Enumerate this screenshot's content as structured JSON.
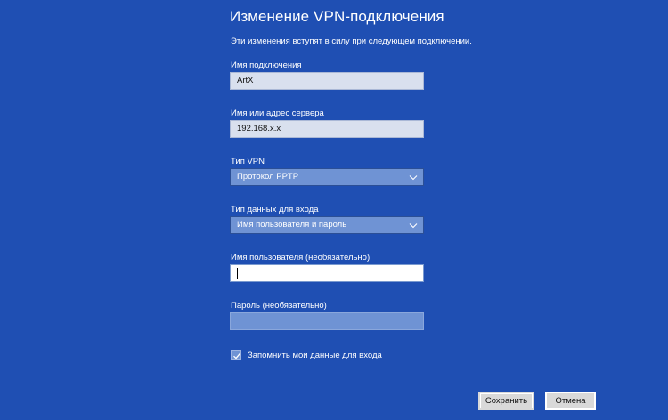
{
  "dialog": {
    "title": "Изменение VPN-подключения",
    "subtitle": "Эти изменения вступят в силу при следующем подключении."
  },
  "fields": {
    "connection_name": {
      "label": "Имя подключения",
      "value": "ArtX"
    },
    "server_address": {
      "label": "Имя или адрес сервера",
      "value": "192.168.x.x"
    },
    "vpn_type": {
      "label": "Тип VPN",
      "selected": "Протокол PPTP"
    },
    "signin_type": {
      "label": "Тип данных для входа",
      "selected": "Имя пользователя и пароль"
    },
    "username": {
      "label": "Имя пользователя (необязательно)",
      "value": ""
    },
    "password": {
      "label": "Пароль (необязательно)",
      "value": ""
    }
  },
  "remember": {
    "label": "Запомнить мои данные для входа",
    "checked": true
  },
  "buttons": {
    "save": "Сохранить",
    "cancel": "Отмена"
  },
  "colors": {
    "background": "#1f4fb3",
    "field_light": "#d9e0ee",
    "field_dark": "#6f93d4",
    "button": "#d9d9d9"
  }
}
